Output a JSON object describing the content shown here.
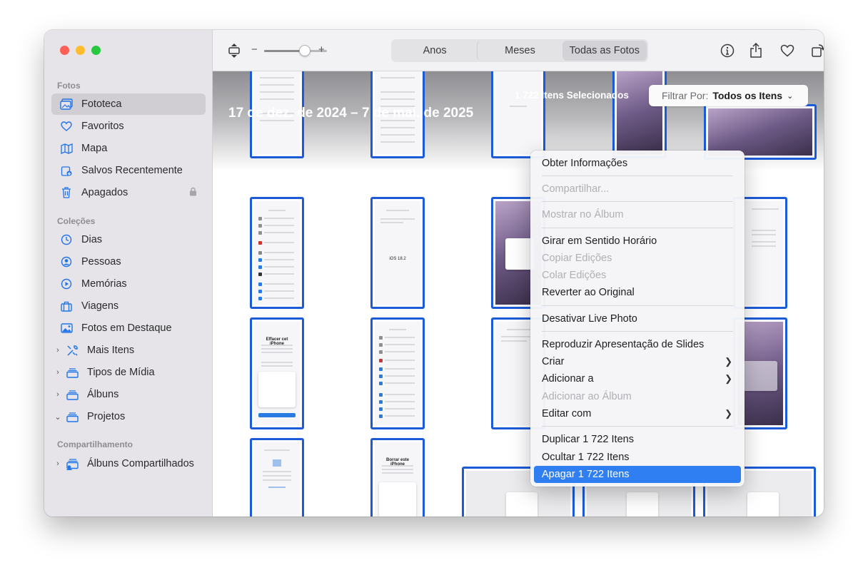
{
  "sidebar": {
    "sections": {
      "fotos": "Fotos",
      "colecoes": "Coleções",
      "compartilhamento": "Compartilhamento"
    },
    "fotos_items": [
      {
        "label": "Fototeca",
        "icon": "photo-library-icon",
        "selected": true
      },
      {
        "label": "Favoritos",
        "icon": "heart-icon"
      },
      {
        "label": "Mapa",
        "icon": "map-icon"
      },
      {
        "label": "Salvos Recentemente",
        "icon": "recently-saved-icon"
      },
      {
        "label": "Apagados",
        "icon": "trash-icon",
        "locked": true
      }
    ],
    "colecoes_items": [
      {
        "label": "Dias",
        "icon": "clock-icon"
      },
      {
        "label": "Pessoas",
        "icon": "person-icon"
      },
      {
        "label": "Memórias",
        "icon": "memories-icon"
      },
      {
        "label": "Viagens",
        "icon": "suitcase-icon"
      },
      {
        "label": "Fotos em Destaque",
        "icon": "featured-photo-icon"
      },
      {
        "label": "Mais Itens",
        "icon": "tools-icon",
        "chevron": "right"
      },
      {
        "label": "Tipos de Mídia",
        "icon": "stack-icon",
        "chevron": "right"
      },
      {
        "label": "Álbuns",
        "icon": "stack-icon",
        "chevron": "right"
      },
      {
        "label": "Projetos",
        "icon": "stack-icon",
        "chevron": "down"
      }
    ],
    "compartilhamento_items": [
      {
        "label": "Álbuns Compartilhados",
        "icon": "shared-albums-icon",
        "chevron": "right"
      }
    ]
  },
  "toolbar": {
    "zoom_minus": "−",
    "zoom_plus": "+",
    "zoom_level": 0.65,
    "tabs": [
      "Anos",
      "Meses",
      "Todas as Fotos"
    ],
    "active_tab": "Todas as Fotos"
  },
  "content": {
    "date_range": "17 de dez. de 2024 – 7 de mai. de 2025",
    "selection_count": "1 722 Itens Selecionados",
    "filter_label": "Filtrar Por:",
    "filter_value": "Todos os Itens"
  },
  "thumb_texts": {
    "effacer": "Effacer cet iPhone",
    "borrar": "Borrar este iPhone",
    "ios": "iOS 18.2"
  },
  "context_menu": {
    "items": [
      {
        "label": "Obter Informações",
        "disabled": false
      },
      {
        "label": "Compartilhar...",
        "disabled": true
      },
      {
        "label": "Mostrar no Álbum",
        "disabled": true
      },
      {
        "label": "Girar em Sentido Horário",
        "disabled": false
      },
      {
        "label": "Copiar Edições",
        "disabled": true
      },
      {
        "label": "Colar Edições",
        "disabled": true
      },
      {
        "label": "Reverter ao Original",
        "disabled": false
      },
      {
        "label": "Desativar Live Photo",
        "disabled": false
      },
      {
        "label": "Reproduzir Apresentação de Slides",
        "disabled": false
      },
      {
        "label": "Criar",
        "disabled": false,
        "submenu": true
      },
      {
        "label": "Adicionar a",
        "disabled": false,
        "submenu": true
      },
      {
        "label": "Adicionar ao Álbum",
        "disabled": true
      },
      {
        "label": "Editar com",
        "disabled": false,
        "submenu": true
      },
      {
        "label": "Duplicar 1 722 Itens",
        "disabled": false
      },
      {
        "label": "Ocultar 1 722 Itens",
        "disabled": false
      },
      {
        "label": "Apagar 1 722 Itens",
        "disabled": false,
        "highlighted": true
      }
    ]
  },
  "colors": {
    "accent": "#1f74e8",
    "selection_border": "#1c5bd8",
    "menu_highlight": "#2f7ff2"
  }
}
